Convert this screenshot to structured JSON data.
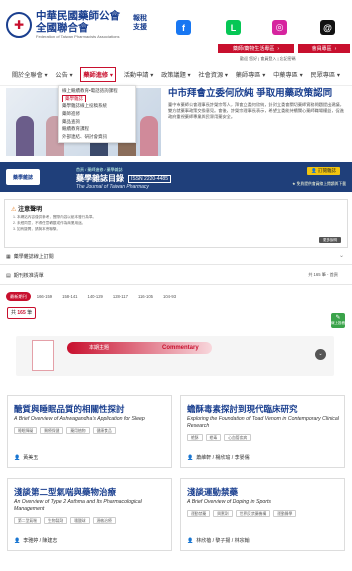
{
  "header": {
    "org_name_1": "中華民國藥師公會",
    "org_name_2": "全國聯合會",
    "org_name_en": "Federation of Taiwan Pharmacists Associations",
    "report_line1": "報稅",
    "report_line2": "支援",
    "social": [
      {
        "name": "facebook-icon",
        "label": "f",
        "color": "#1877f2"
      },
      {
        "name": "line-icon",
        "label": "L",
        "color": "#06c755"
      },
      {
        "name": "instagram-icon",
        "label": "◎",
        "color": "#d6249f"
      },
      {
        "name": "threads-icon",
        "label": "@",
        "color": "#111111"
      }
    ],
    "btn_members": "藥師/藥物生活專區",
    "btn_members_color": "#c8102e",
    "btn_join": "會員專區",
    "btn_join_color": "#c8102e",
    "login_text": "歡迎 您好 | 會員登入 | 忘記密碼"
  },
  "nav": {
    "items": [
      "關於全聯會",
      "公告",
      "藥師進修",
      "活動申請",
      "政策議題",
      "社會資源",
      "藥師專區",
      "中藥專區",
      "民眾專區"
    ],
    "active_index": 2
  },
  "dropdown": {
    "items": [
      "線上繼續教育•電話諮詢課程",
      "藥學雜誌",
      "藥學雜誌線上投稿系統",
      "藥師進修",
      "藥品查詢",
      "繼續教育課程",
      "外部連結、研討會資訊"
    ],
    "highlight_index": 1
  },
  "news": {
    "title": "中市拜會立委何欣純 爭取用藥政策認同",
    "body": "臺中市藥師公會理事長許榮宗等人，拜會立委何欣純，針對立委會關切藥師實務問題提出建議，雙方就藥事政策交換意見。會後，許榮宗理事長表示，希望立委能持續關心藥師職場權益，促進政府重視藥師專業與民眾用藥安全。"
  },
  "journal": {
    "logo_text": "藥學雜誌",
    "breadcrumb": "首頁 / 藥師進修 / 藥學雜誌",
    "title": "藥學雜誌目錄",
    "issn": "ISSN 2220-4485",
    "title_en": "The Journal of Taiwan Pharmacy",
    "subscribe": "訂閱雜誌",
    "note": "★ 免費提供會員線上閱讀與下載"
  },
  "notice": {
    "heading": "注意聲明",
    "lines": [
      "1. 本網站內容僅供參考，實際內容以紙本發行為準。",
      "2. 未經同意，不得任意轉載或作為商業用途。",
      "3. 如有疑問，請與本會聯繫。"
    ],
    "more": "更多說明"
  },
  "sections": {
    "subscribe": "藥學雜誌線上訂閱",
    "issues": "期刊核准清單",
    "count": "共 165 筆 - 首頁"
  },
  "tabs": [
    "最新期刊",
    "166-159",
    "158-141",
    "140-129",
    "128-117",
    "116-105",
    "104-93"
  ],
  "tabs_active": 0,
  "total_prefix": "共",
  "total_value": "165",
  "total_suffix": "筆",
  "qr_label": "線上投稿",
  "banner": {
    "pill": "本期主題",
    "commentary": "Commentary"
  },
  "articles": [
    {
      "title": "醣質與睡眠品質的相關性探討",
      "title_en": "A Brief Overview of Ashwagandha's Application for Sleep",
      "tags": [
        "睡眠障礙",
        "醫療保健",
        "藥用植物",
        "健康食品"
      ],
      "authors": "黃美玉"
    },
    {
      "title": "蟾酥毒素探討到現代臨床研究",
      "title_en": "Exploring the Foundation of Toad Venom in Contemporary Clinical Research",
      "tags": [
        "蟾酥",
        "蟾毒",
        "心血管疾病"
      ],
      "authors": "蕭維軒 / 楊欣瑜 / 李晏儒"
    },
    {
      "title": "淺談第二型氣喘與藥物治療",
      "title_en": "An Overview of Type 2 Asthma and Its Pharmacological Management",
      "tags": [
        "第二型氣喘",
        "生物製劑",
        "嗜酸球",
        "過敏治療"
      ],
      "authors": "李雅婷 / 陳建志"
    },
    {
      "title": "淺談運動禁藥",
      "title_en": "A Brief Overview of Doping in Sports",
      "tags": [
        "運動禁藥",
        "興奮劑",
        "世界反禁藥機構",
        "運動醫學"
      ],
      "authors": "林欣蓓 / 黎子揚 / 林宗翰"
    }
  ]
}
